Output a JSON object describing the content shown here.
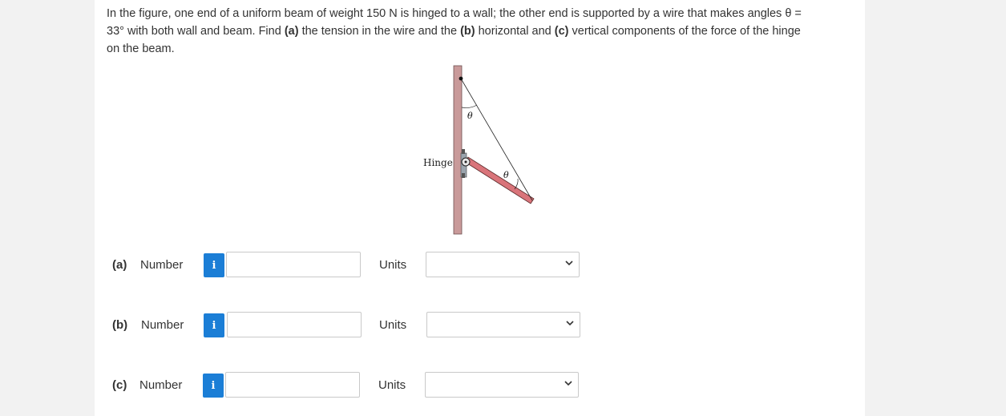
{
  "question": {
    "line1": "In the figure, one end of a uniform beam of weight 150 N is hinged to a wall; the other end is supported by a wire that makes angles θ =",
    "line2_pre": "33° with both wall and beam. Find ",
    "part_a": "(a)",
    "line2_mid1": " the tension in the wire and the ",
    "part_b": "(b)",
    "line2_mid2": " horizontal and ",
    "part_c": "(c)",
    "line2_post": " vertical components of the force of the hinge",
    "line3": "on the beam."
  },
  "figure": {
    "hinge_label": "Hinge",
    "theta_top": "θ",
    "theta_beam": "θ",
    "colors": {
      "wall": "#c99a9a",
      "beam": "#d9747a"
    }
  },
  "answers": [
    {
      "part": "(a)",
      "number_label": "Number",
      "info": "i",
      "value": "",
      "units_label": "Units",
      "unit_selected": ""
    },
    {
      "part": "(b)",
      "number_label": "Number",
      "info": "i",
      "value": "",
      "units_label": "Units",
      "unit_selected": ""
    },
    {
      "part": "(c)",
      "number_label": "Number",
      "info": "i",
      "value": "",
      "units_label": "Units",
      "unit_selected": ""
    }
  ],
  "colors": {
    "info_button": "#1b7ed6",
    "input_border": "#c9c9c9"
  }
}
